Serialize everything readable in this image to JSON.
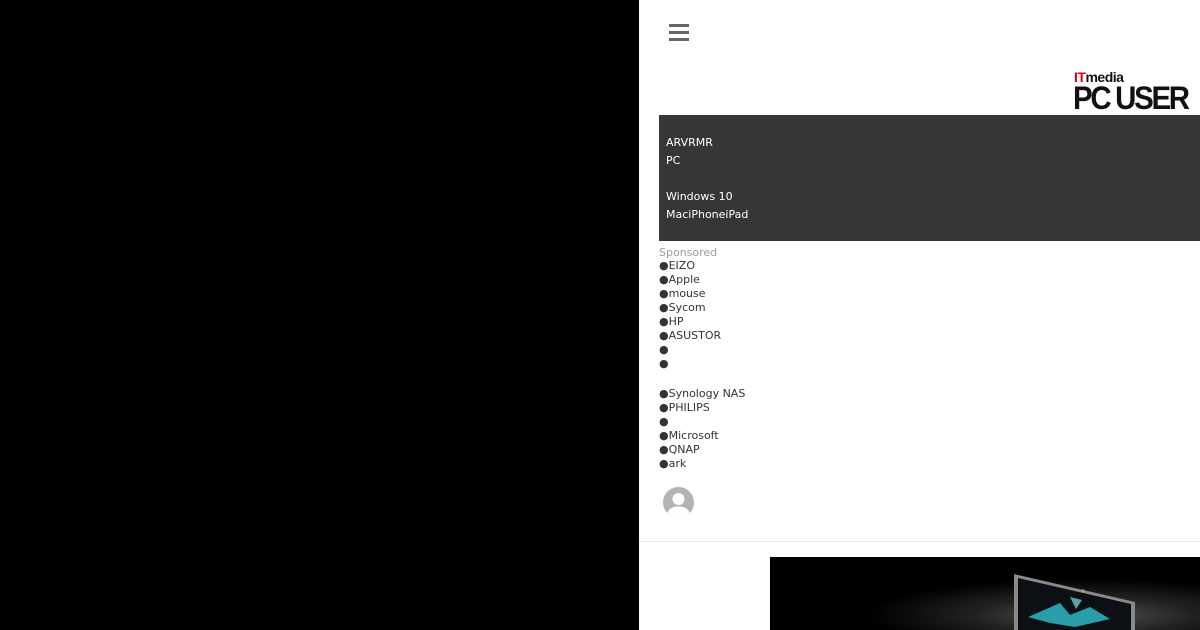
{
  "menu_icon": "hamburger-menu-icon",
  "logo": {
    "top_red": "IT",
    "top_black": "media",
    "main": "PC USER"
  },
  "nav_menu": {
    "items": [
      "ARVRMR",
      "PC",
      "Windows 10",
      "MaciPhoneiPad"
    ]
  },
  "sponsored": {
    "label": "Sponsored",
    "bullet": "●",
    "items": [
      "EIZO",
      "Apple",
      "mouse",
      "Sycom",
      "HP",
      "ASUSTOR",
      "",
      "",
      "Synology NAS",
      "PHILIPS",
      "",
      "Microsoft",
      "QNAP",
      "ark"
    ]
  },
  "user": {
    "avatar_icon": "user-avatar-icon"
  },
  "colors": {
    "background": "#000000",
    "panel": "#ffffff",
    "menu_bg": "#353638",
    "logo_red": "#e60012",
    "sponsored_label": "#9a9a9a"
  }
}
